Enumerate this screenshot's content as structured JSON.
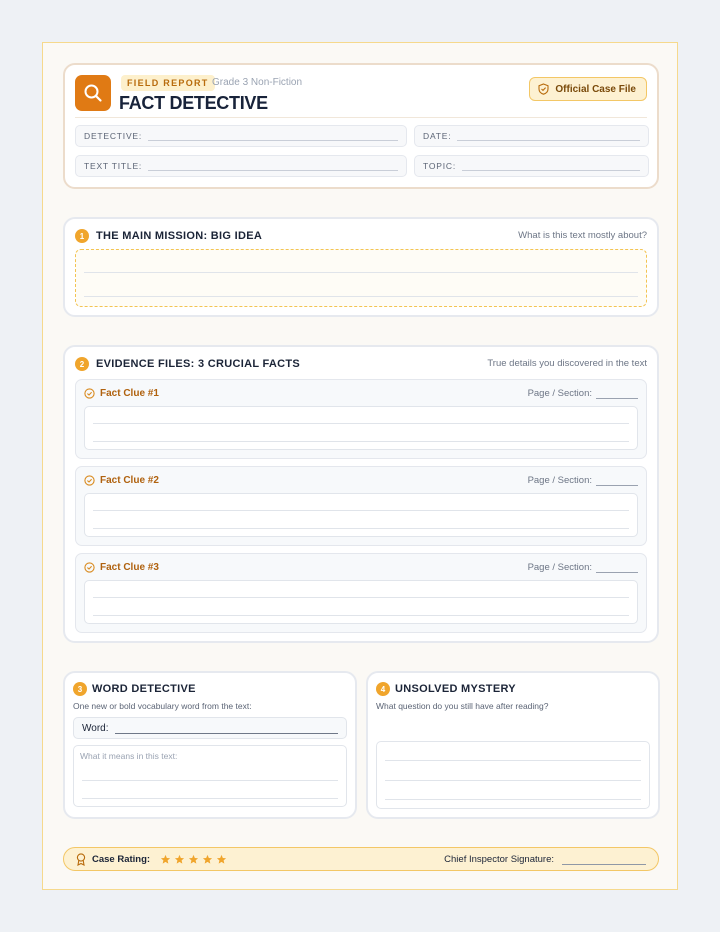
{
  "header": {
    "tag": "FIELD REPORT",
    "grade": "Grade 3 Non-Fiction",
    "title": "FACT DETECTIVE",
    "official": "Official Case File",
    "fields": {
      "detective": "DETECTIVE:",
      "date": "DATE:",
      "text_title": "TEXT TITLE:",
      "topic": "TOPIC:"
    },
    "icons": {
      "logo": "magnifier-icon",
      "official": "shield-check-icon"
    }
  },
  "mission": {
    "number": "1",
    "title": "THE MAIN MISSION: BIG IDEA",
    "hint": "What is this text mostly about?"
  },
  "evidence": {
    "number": "2",
    "title": "EVIDENCE FILES: 3 CRUCIAL FACTS",
    "hint": "True details you discovered in the text",
    "clues": [
      {
        "label": "Fact Clue #1",
        "page_label": "Page / Section:"
      },
      {
        "label": "Fact Clue #2",
        "page_label": "Page / Section:"
      },
      {
        "label": "Fact Clue #3",
        "page_label": "Page / Section:"
      }
    ]
  },
  "word": {
    "number": "3",
    "title": "WORD DETECTIVE",
    "subtitle": "One new or bold vocabulary word from the text:",
    "word_label": "Word:",
    "means_placeholder": "What it means in this text:"
  },
  "mystery": {
    "number": "4",
    "title": "UNSOLVED MYSTERY",
    "subtitle": "What question do you still have after reading?"
  },
  "footer": {
    "rating_label": "Case Rating:",
    "stars": 5,
    "signature_label": "Chief Inspector Signature:"
  },
  "colors": {
    "accent": "#e07a14",
    "badge": "#f0a52c",
    "tag_bg": "#fdf0cc"
  }
}
